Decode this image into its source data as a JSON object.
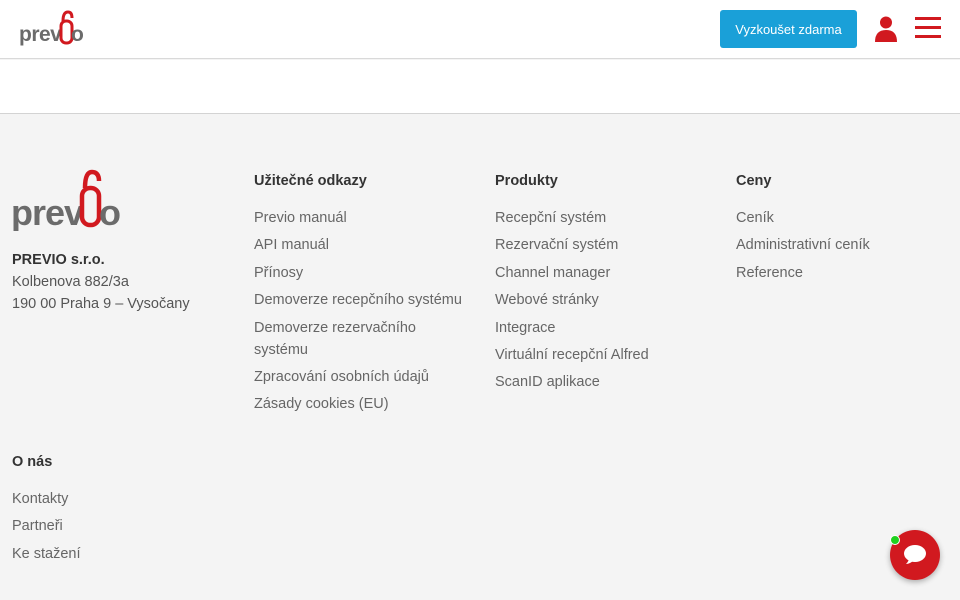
{
  "header": {
    "logo_text": "previo",
    "cta_label": "Vyzkoušet zdarma",
    "user_icon": "user-icon",
    "menu_icon": "hamburger-menu-icon"
  },
  "company": {
    "logo_text": "previo",
    "name": "PREVIO s.r.o.",
    "street": "Kolbenova 882/3a",
    "city": "190 00 Praha 9 – Vysočany"
  },
  "useful_links": {
    "title": "Užitečné odkazy",
    "items": [
      "Previo manuál",
      "API manuál",
      "Přínosy",
      "Demoverze recepčního systému",
      "Demoverze rezervačního systému",
      "Zpracování osobních údajů",
      "Zásady cookies (EU)"
    ]
  },
  "products": {
    "title": "Produkty",
    "items": [
      "Recepční systém",
      "Rezervační systém",
      "Channel manager",
      "Webové stránky",
      "Integrace",
      "Virtuální recepční Alfred",
      "ScanID aplikace"
    ]
  },
  "prices": {
    "title": "Ceny",
    "items": [
      "Ceník",
      "Administrativní ceník",
      "Reference"
    ]
  },
  "about": {
    "title": "O nás",
    "items": [
      "Kontakty",
      "Partneři",
      "Ke stažení"
    ]
  },
  "chat": {
    "icon": "chat-bubble-icon",
    "status": "online-status-dot"
  },
  "colors": {
    "brand_red": "#d1191f",
    "cta_blue": "#1aa0d8",
    "logo_gray": "#6b6b6b"
  }
}
